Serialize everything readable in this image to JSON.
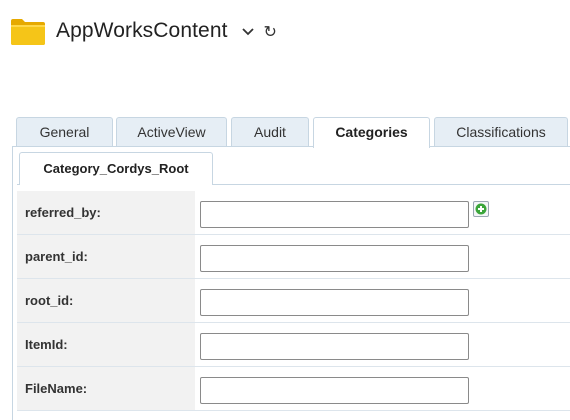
{
  "header": {
    "title": "AppWorksContent",
    "refresh_glyph": "↻"
  },
  "tabs": [
    {
      "label": "General",
      "active": false
    },
    {
      "label": "ActiveView",
      "active": false
    },
    {
      "label": "Audit",
      "active": false
    },
    {
      "label": "Categories",
      "active": true
    },
    {
      "label": "Classifications",
      "active": false
    }
  ],
  "subtab": {
    "label": "Category_Cordys_Root"
  },
  "fields": [
    {
      "label": "referred_by:",
      "value": "",
      "has_add_button": true
    },
    {
      "label": "parent_id:",
      "value": ""
    },
    {
      "label": "root_id:",
      "value": ""
    },
    {
      "label": "ItemId:",
      "value": ""
    },
    {
      "label": "FileName:",
      "value": ""
    }
  ],
  "icons": {
    "folder": "folder-icon",
    "dropdown": "chevron-down-icon",
    "refresh": "refresh-icon",
    "add": "plus-icon"
  },
  "colors": {
    "tab_border": "#c7d6e2",
    "tab_bg": "#e6eef5",
    "label_bg": "#f2f2f2",
    "folder": "#f5c518",
    "add_icon": "#3aa53a"
  }
}
